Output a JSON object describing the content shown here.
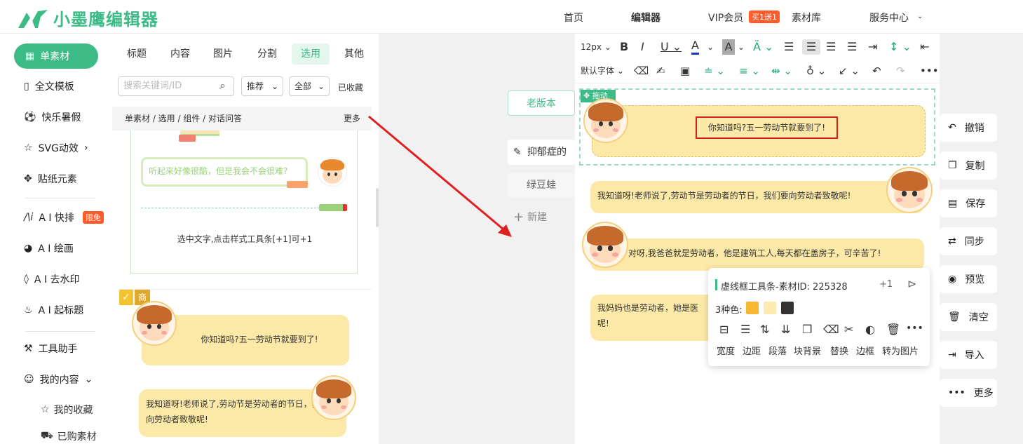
{
  "topbar": {
    "logo_text": "小墨鹰编辑器",
    "nav": [
      "首页",
      "编辑器",
      "VIP会员",
      "素材库",
      "服务中心"
    ],
    "vip_badge": "买1送1"
  },
  "sidebar": {
    "items": [
      {
        "label": "单素材",
        "icon": "grid-icon"
      },
      {
        "label": "全文模板",
        "icon": "template-icon"
      },
      {
        "label": "快乐暑假",
        "icon": "ball-icon"
      },
      {
        "label": "SVG动效",
        "icon": "star-icon"
      },
      {
        "label": "贴纸元素",
        "icon": "puzzle-icon"
      },
      {
        "label": "A I 快排",
        "icon": "ai-icon",
        "badge": "限免"
      },
      {
        "label": "A I 绘画",
        "icon": "palette-icon"
      },
      {
        "label": "A I 去水印",
        "icon": "drop-icon"
      },
      {
        "label": "A I 起标题",
        "icon": "flame-icon"
      },
      {
        "label": "工具助手",
        "icon": "tool-icon"
      },
      {
        "label": "我的内容",
        "icon": "user-icon"
      }
    ],
    "sub_items": [
      "我的收藏",
      "已购素材"
    ]
  },
  "panel": {
    "tabs": [
      "标题",
      "内容",
      "图片",
      "分割",
      "选用",
      "其他"
    ],
    "search_placeholder": "搜索关键词/ID",
    "dropdowns": [
      "推荐",
      "全部"
    ],
    "favorites": "已收藏",
    "breadcrumb": "单素材 / 选用 / 组件 / 对话问答",
    "more": "更多",
    "card1": {
      "bubble_text": "听起来好像很酷，但是我会不会很难?",
      "hint": "选中文字,点击样式工具条[+1]可+1"
    },
    "card2": {
      "badge": "商",
      "bubble1": "你知道吗?五一劳动节就要到了!",
      "bubble2": "我知道呀!老师说了,劳动节是劳动者的节日，我们要向劳动者致敬呢!"
    }
  },
  "versions": {
    "old_version": "老版本",
    "docs": [
      "抑郁症的",
      "绿豆蛙"
    ],
    "new": "新建"
  },
  "toolbar": {
    "font_size": "12px",
    "font_family": "默认字体"
  },
  "canvas": {
    "drag_label": "拖动",
    "bubbles": [
      "你知道吗?五一劳动节就要到了!",
      "我知道呀!老师说了,劳动节是劳动者的节日，我们要向劳动者致敬呢!",
      "对呀,我爸爸就是劳动者，他是建筑工人,每天都在盖房子，可辛苦了!",
      "我妈妈也是劳动者，她是医",
      "呢!"
    ]
  },
  "popup": {
    "title": "虚线框工具条-素材ID: 225328",
    "plus_one": "+1",
    "colors_label": "3种色:",
    "colors": [
      "#f7b733",
      "#fceab1",
      "#333333"
    ],
    "actions": [
      "宽度",
      "边距",
      "段落",
      "块背景",
      "替换",
      "边框",
      "转为图片"
    ]
  },
  "right_actions": [
    "撤销",
    "复制",
    "保存",
    "同步",
    "预览",
    "清空",
    "导入",
    "更多"
  ],
  "accent": "#3dbb86",
  "arrow_color": "#e02020"
}
